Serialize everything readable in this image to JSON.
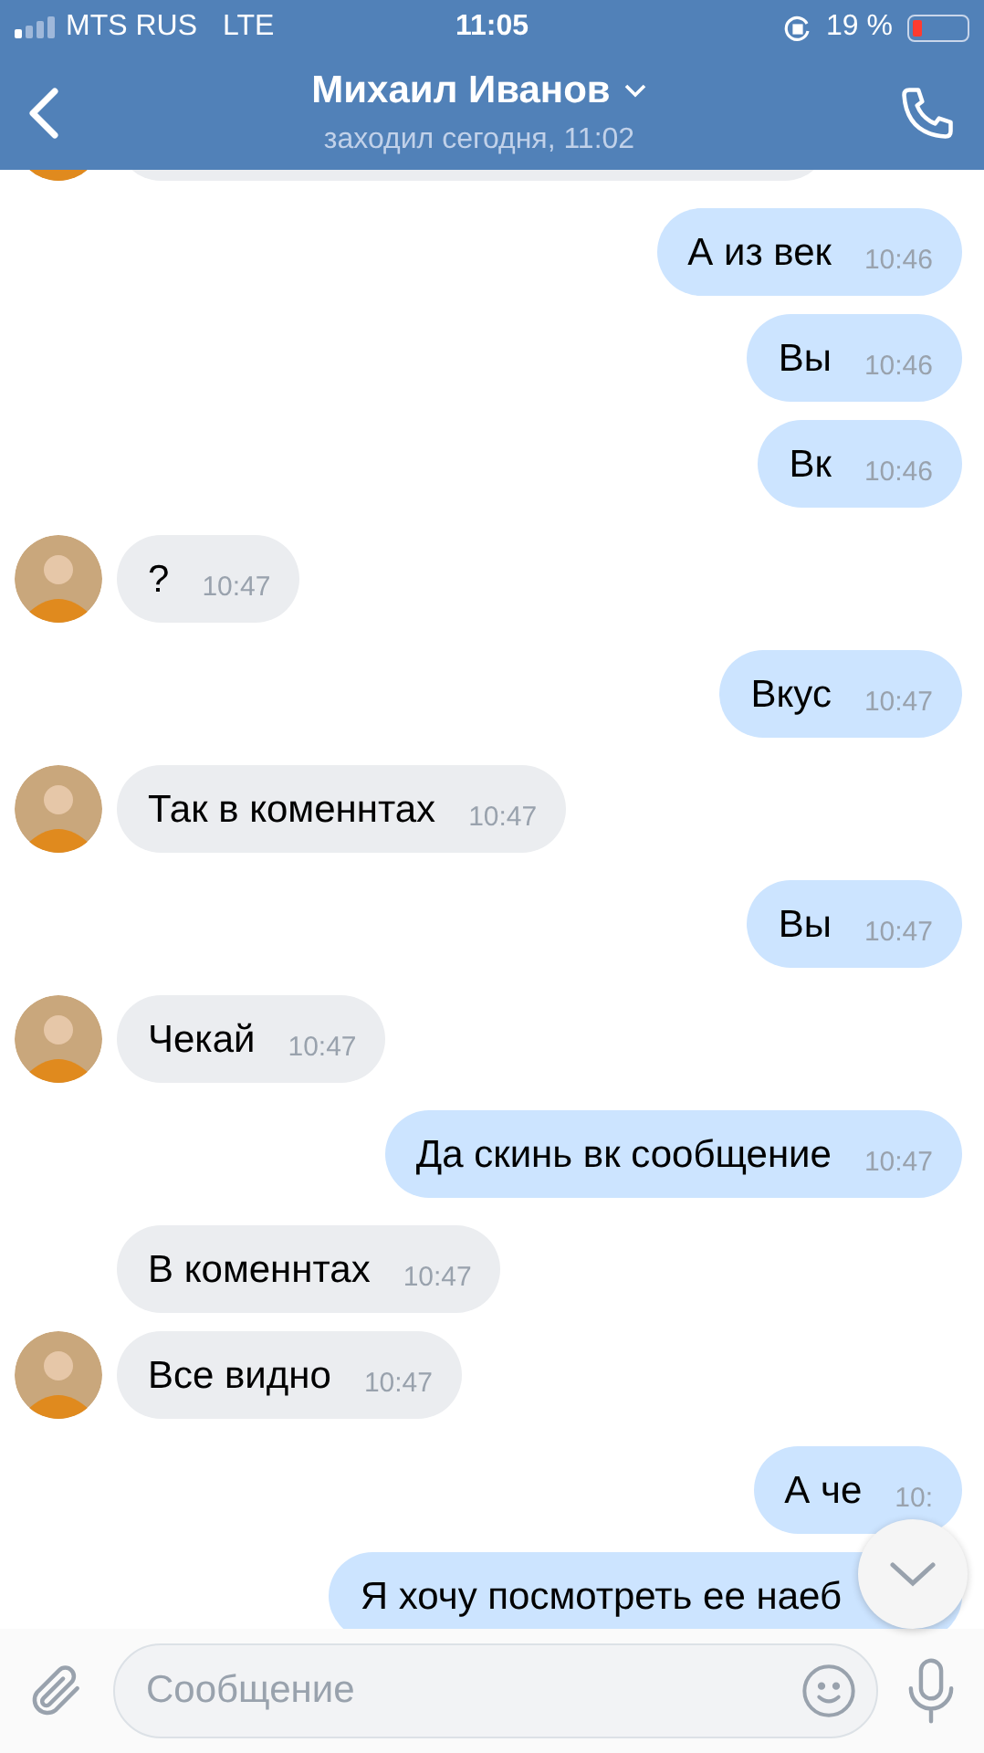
{
  "status_bar": {
    "carrier": "MTS RUS",
    "network": "LTE",
    "time": "11:05",
    "battery": "19 %"
  },
  "header": {
    "title": "Михаил Иванов",
    "subtitle": "заходил сегодня, 11:02"
  },
  "messages": [
    {
      "outgoing": false,
      "avatar": true,
      "cut": true
    },
    {
      "outgoing": true,
      "text": "А из век",
      "time": "10:46"
    },
    {
      "outgoing": true,
      "text": "Вы",
      "time": "10:46"
    },
    {
      "outgoing": true,
      "text": "Вк",
      "time": "10:46"
    },
    {
      "outgoing": false,
      "avatar": true,
      "text": "?",
      "time": "10:47"
    },
    {
      "outgoing": true,
      "text": "Вкус",
      "time": "10:47"
    },
    {
      "outgoing": false,
      "avatar": true,
      "text": "Так в коменнтах",
      "time": "10:47"
    },
    {
      "outgoing": true,
      "text": "Вы",
      "time": "10:47"
    },
    {
      "outgoing": false,
      "avatar": true,
      "text": "Чекай",
      "time": "10:47"
    },
    {
      "outgoing": true,
      "text": "Да скинь вк сообщение",
      "time": "10:47"
    },
    {
      "outgoing": false,
      "avatar": false,
      "text": "В коменнтах",
      "time": "10:47"
    },
    {
      "outgoing": false,
      "avatar": true,
      "text": "Все видно",
      "time": "10:47"
    },
    {
      "outgoing": true,
      "text": "А че",
      "time": "10:"
    },
    {
      "outgoing": true,
      "text": "Я хочу посмотреть ее наеб"
    }
  ],
  "composer": {
    "placeholder": "Сообщение"
  }
}
